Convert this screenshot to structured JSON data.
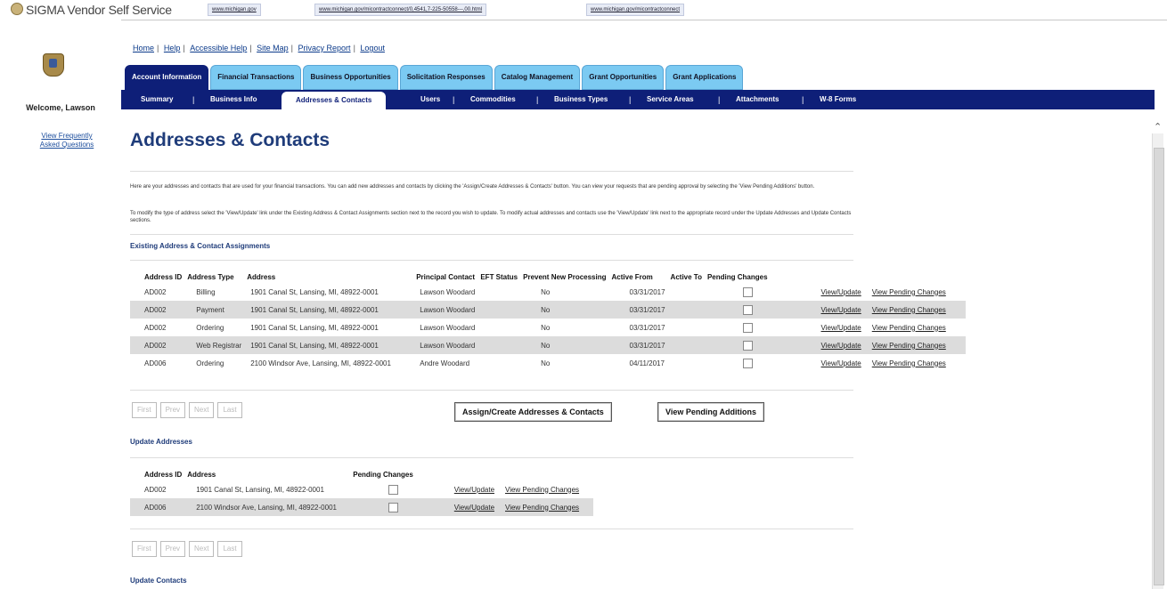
{
  "brand": "SIGMA Vendor Self Service",
  "urls": [
    "www.michigan.gov",
    "www.michigan.gov/micontractconnect/0,4541,7-225-50558---,00.html",
    "www.michigan.gov/micontractconnect"
  ],
  "sidebar": {
    "welcome": "Welcome, Lawson",
    "faq": "View Frequently Asked Questions"
  },
  "toplinks": [
    "Home",
    "Help",
    "Accessible Help",
    "Site Map",
    "Privacy Report",
    "Logout"
  ],
  "tabs": [
    "Account Information",
    "Financial Transactions",
    "Business Opportunities",
    "Solicitation Responses",
    "Catalog Management",
    "Grant Opportunities",
    "Grant Applications"
  ],
  "subnav": [
    "Summary",
    "Business Info",
    "Addresses & Contacts",
    "Users",
    "Commodities",
    "Business Types",
    "Service Areas",
    "Attachments",
    "W-8 Forms"
  ],
  "page_title": "Addresses & Contacts",
  "intro1": "Here are your addresses and contacts that are used for your financial transactions. You can add new addresses and contacts by clicking the 'Assign/Create Addresses & Contacts' button. You can view your requests that are pending approval by selecting the 'View Pending Additions' button.",
  "intro2": "To modify the type of address select the 'View/Update' link under the Existing Address & Contact Assignments section next to the record you wish to update. To modify actual addresses and contacts use the 'View/Update' link next to the appropriate record under the Update Addresses and Update Contacts sections.",
  "assignments": {
    "heading": "Existing Address & Contact Assignments",
    "columns": [
      "Address ID",
      "Address Type",
      "Address",
      "Principal Contact",
      "EFT Status",
      "Prevent New Processing",
      "Active From",
      "Active To",
      "Pending Changes"
    ],
    "rows": [
      {
        "id": "AD002",
        "type": "Billing",
        "address": "1901 Canal St, Lansing, MI, 48922-0001",
        "contact": "Lawson Woodard",
        "eft": "",
        "prevent": "No",
        "from": "03/31/2017",
        "to": "",
        "link1": "View/Update",
        "link2": "View Pending Changes"
      },
      {
        "id": "AD002",
        "type": "Payment",
        "address": "1901 Canal St, Lansing, MI, 48922-0001",
        "contact": "Lawson Woodard",
        "eft": "",
        "prevent": "No",
        "from": "03/31/2017",
        "to": "",
        "link1": "View/Update",
        "link2": "View Pending Changes"
      },
      {
        "id": "AD002",
        "type": "Ordering",
        "address": "1901 Canal St, Lansing, MI, 48922-0001",
        "contact": "Lawson Woodard",
        "eft": "",
        "prevent": "No",
        "from": "03/31/2017",
        "to": "",
        "link1": "View/Update",
        "link2": "View Pending Changes"
      },
      {
        "id": "AD002",
        "type": "Web Registrar",
        "address": "1901 Canal St, Lansing, MI, 48922-0001",
        "contact": "Lawson Woodard",
        "eft": "",
        "prevent": "No",
        "from": "03/31/2017",
        "to": "",
        "link1": "View/Update",
        "link2": "View Pending Changes"
      },
      {
        "id": "AD006",
        "type": "Ordering",
        "address": "2100 Windsor Ave, Lansing, MI, 48922-0001",
        "contact": "Andre Woodard",
        "eft": "",
        "prevent": "No",
        "from": "04/11/2017",
        "to": "",
        "link1": "View/Update",
        "link2": "View Pending Changes"
      }
    ]
  },
  "pager": [
    "First",
    "Prev",
    "Next",
    "Last"
  ],
  "buttons": {
    "assign": "Assign/Create Addresses & Contacts",
    "pending": "View Pending Additions"
  },
  "addresses": {
    "heading": "Update Addresses",
    "columns": [
      "Address ID",
      "Address",
      "Pending Changes"
    ],
    "rows": [
      {
        "id": "AD002",
        "address": "1901 Canal St, Lansing, MI, 48922-0001",
        "link1": "View/Update",
        "link2": "View Pending Changes"
      },
      {
        "id": "AD006",
        "address": "2100 Windsor Ave, Lansing, MI, 48922-0001",
        "link1": "View/Update",
        "link2": "View Pending Changes"
      }
    ]
  },
  "contacts_heading": "Update Contacts"
}
